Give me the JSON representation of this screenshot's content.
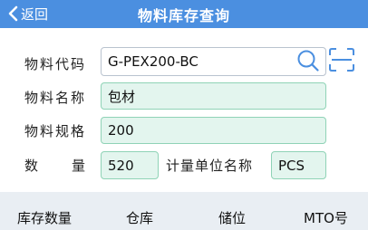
{
  "header": {
    "back_label": "返回",
    "title": "物料库存查询"
  },
  "form": {
    "material_code": {
      "label": "物料代码",
      "value": "G-PEX200-BC"
    },
    "material_name": {
      "label": "物料名称",
      "value": "包材"
    },
    "material_spec": {
      "label": "物料规格",
      "value": "200"
    },
    "quantity": {
      "label": "数　量",
      "value": "520"
    },
    "unit_name": {
      "label": "计量单位名称",
      "value": "PCS"
    }
  },
  "table": {
    "columns": [
      "库存数量",
      "仓库",
      "储位",
      "MTO号"
    ]
  },
  "colors": {
    "header_bg": "#4b8fe0",
    "field_bg": "#e3f5ee",
    "field_border": "#8fd3b6",
    "table_header_bg": "#e9eef3"
  },
  "icons": [
    "chevron-left-icon",
    "search-icon",
    "scan-icon"
  ]
}
